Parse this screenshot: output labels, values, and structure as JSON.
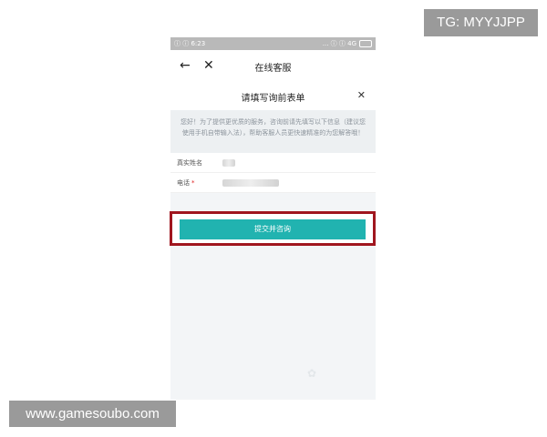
{
  "watermarks": {
    "top": "TG: MYYJJPP",
    "bottom": "www.gamesoubo.com"
  },
  "statusbar": {
    "time": "ⓘ ⓘ 6:23",
    "signal": "... ⓘ ⓘ 4G"
  },
  "navbar": {
    "back_icon": "←",
    "close_icon": "✕",
    "title": "在线客服"
  },
  "form": {
    "title": "请填写询前表单",
    "close_icon": "✕",
    "notice": "您好！为了提供更优质的服务，咨询前请先填写以下信息（建议您使用手机自带输入法），帮助客服人员更快速精准的为您解答哦！",
    "fields": [
      {
        "label": "真实姓名",
        "required": false
      },
      {
        "label": "电话",
        "required": true,
        "required_mark": "*"
      }
    ],
    "submit_label": "提交并咨询"
  },
  "colors": {
    "accent": "#21b3b0",
    "highlight_border": "#a0161f"
  }
}
